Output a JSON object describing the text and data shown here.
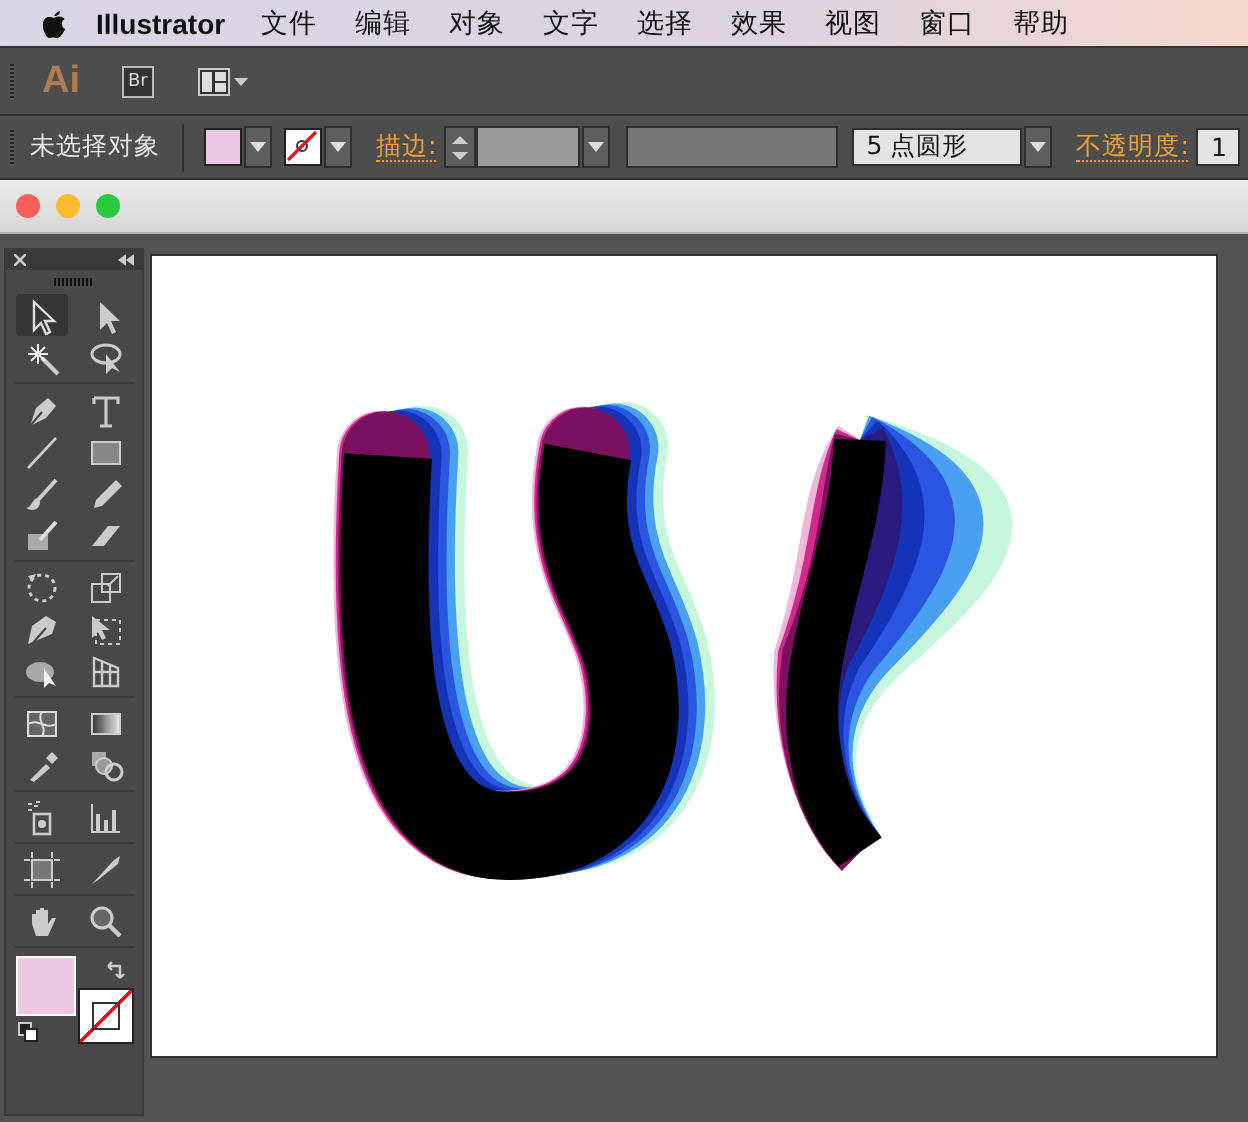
{
  "menu_bar": {
    "app_name": "Illustrator",
    "menus": [
      "文件",
      "编辑",
      "对象",
      "文字",
      "选择",
      "效果",
      "视图",
      "窗口",
      "帮助"
    ]
  },
  "app_bar": {
    "logo": "Ai",
    "bridge_button": "Br"
  },
  "control_bar": {
    "selection_label": "未选择对象",
    "stroke_label": "描边:",
    "brush": "5 点圆形",
    "opacity_label": "不透明度:",
    "opacity_value": "1"
  },
  "fill": {
    "color": "#edc8e4"
  },
  "stroke": {
    "none": true
  },
  "tools": [
    {
      "selected": true
    },
    {
      "selected": false
    },
    {
      "selected": false
    },
    {
      "selected": false
    },
    {
      "selected": false
    },
    {
      "selected": false
    },
    {
      "selected": false
    },
    {
      "selected": false
    },
    {
      "selected": false
    },
    {
      "selected": false
    },
    {
      "selected": false
    },
    {
      "selected": false
    },
    {
      "selected": false
    },
    {
      "selected": false
    },
    {
      "selected": false
    },
    {
      "selected": false
    },
    {
      "selected": false
    },
    {
      "selected": false
    },
    {
      "selected": false
    },
    {
      "selected": false
    },
    {
      "selected": false
    },
    {
      "selected": false
    },
    {
      "selected": false
    },
    {
      "selected": false
    },
    {
      "selected": false
    },
    {
      "selected": false
    },
    {
      "selected": false
    },
    {
      "selected": false
    }
  ]
}
